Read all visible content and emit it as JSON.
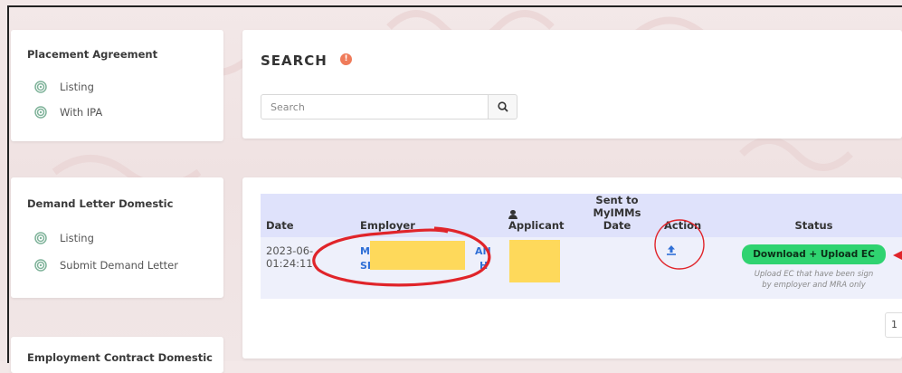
{
  "sidebar": {
    "placement": {
      "title": "Placement Agreement",
      "items": [
        {
          "label": "Listing",
          "icon": "fingerprint-icon"
        },
        {
          "label": "With IPA",
          "icon": "fingerprint-icon"
        }
      ]
    },
    "demand": {
      "title": "Demand Letter Domestic",
      "items": [
        {
          "label": "Listing",
          "icon": "fingerprint-icon"
        },
        {
          "label": "Submit Demand Letter",
          "icon": "fingerprint-icon"
        }
      ]
    },
    "employment": {
      "title": "Employment Contract Domestic"
    }
  },
  "search": {
    "title": "SEARCH",
    "info_icon": "!",
    "placeholder": "Search",
    "button_icon": "search-icon"
  },
  "table": {
    "headers": {
      "date": "Date",
      "employer": "Employer",
      "applicant": "Applicant",
      "sent_line1": "Sent to",
      "sent_line2": "MyIMMs Date",
      "action": "Action",
      "status": "Status"
    },
    "rows": [
      {
        "date_line1": "2023-06-",
        "date_line2": "01:24:11",
        "employer_line1_start": "M",
        "employer_line1_end": "AN",
        "employer_line2_start": "SH",
        "employer_line2_end": "H",
        "status_button": "Download + Upload EC",
        "status_note": "Upload EC that have been sign by employer and MRA only"
      }
    ]
  },
  "pagination": {
    "current": "1"
  },
  "colors": {
    "accent": "#2f6fd6",
    "status_green": "#2fd370",
    "table_header": "#dfe2fb",
    "annotation_red": "#e0242a",
    "redaction": "#fed95b"
  }
}
